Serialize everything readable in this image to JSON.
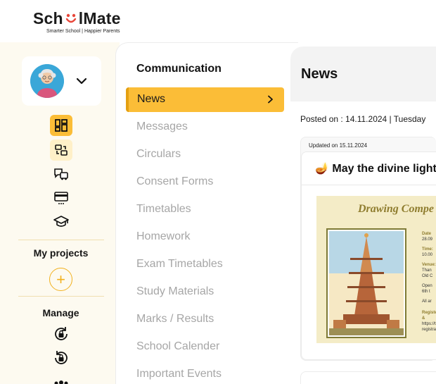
{
  "brand": {
    "name_prefix": "Sch",
    "name_face": "⌣⌣",
    "name_suffix": "lMate",
    "tagline": "Smarter School | Happier Parents"
  },
  "sidebar": {
    "icons": [
      "dashboard-icon",
      "swap-icon",
      "transport-icon",
      "payment-card-icon",
      "graduation-cap-icon"
    ],
    "my_projects_label": "My projects",
    "add_label": "+",
    "manage_label": "Manage",
    "manage_icons": [
      "lock-reset-icon",
      "lock-reset-icon",
      "users-icon"
    ]
  },
  "communication": {
    "title": "Communication",
    "items": [
      {
        "label": "News",
        "active": true
      },
      {
        "label": "Messages"
      },
      {
        "label": "Circulars"
      },
      {
        "label": "Consent Forms"
      },
      {
        "label": "Timetables"
      },
      {
        "label": "Homework"
      },
      {
        "label": "Exam Timetables"
      },
      {
        "label": "Study Materials"
      },
      {
        "label": "Marks / Results"
      },
      {
        "label": "School Calender"
      },
      {
        "label": "Important Events"
      }
    ]
  },
  "news": {
    "title": "News",
    "posted_on": "Posted on : 14.11.2024 | Tuesday",
    "card": {
      "updated": "Updated on 15.11.2024",
      "title": "🪔 May the divine light",
      "poster": {
        "title": "Drawing Compe",
        "side_lines": [
          "Date",
          "28.09",
          "Time:",
          "10.00",
          "Venue:",
          "Than",
          "Old C",
          "Open",
          "6th t",
          "All ar",
          "Register &",
          "https://tha",
          "registration"
        ]
      }
    }
  },
  "colors": {
    "accent": "#fbbd37",
    "rail_bg": "#fdfaf0",
    "muted_text": "#a6a6a6"
  }
}
